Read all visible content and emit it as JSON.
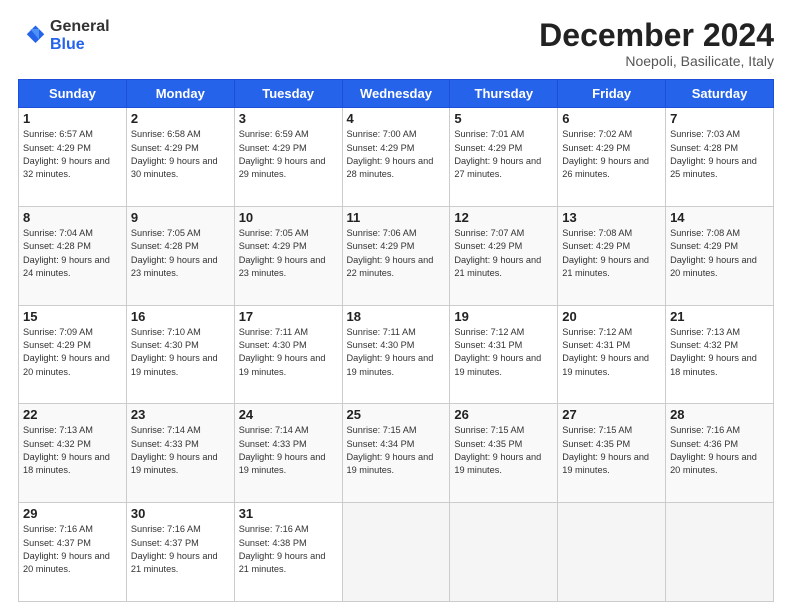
{
  "header": {
    "logo_general": "General",
    "logo_blue": "Blue",
    "month_title": "December 2024",
    "location": "Noepoli, Basilicate, Italy"
  },
  "days_of_week": [
    "Sunday",
    "Monday",
    "Tuesday",
    "Wednesday",
    "Thursday",
    "Friday",
    "Saturday"
  ],
  "weeks": [
    [
      {
        "day": "1",
        "sunrise": "6:57 AM",
        "sunset": "4:29 PM",
        "daylight": "9 hours and 32 minutes."
      },
      {
        "day": "2",
        "sunrise": "6:58 AM",
        "sunset": "4:29 PM",
        "daylight": "9 hours and 30 minutes."
      },
      {
        "day": "3",
        "sunrise": "6:59 AM",
        "sunset": "4:29 PM",
        "daylight": "9 hours and 29 minutes."
      },
      {
        "day": "4",
        "sunrise": "7:00 AM",
        "sunset": "4:29 PM",
        "daylight": "9 hours and 28 minutes."
      },
      {
        "day": "5",
        "sunrise": "7:01 AM",
        "sunset": "4:29 PM",
        "daylight": "9 hours and 27 minutes."
      },
      {
        "day": "6",
        "sunrise": "7:02 AM",
        "sunset": "4:29 PM",
        "daylight": "9 hours and 26 minutes."
      },
      {
        "day": "7",
        "sunrise": "7:03 AM",
        "sunset": "4:28 PM",
        "daylight": "9 hours and 25 minutes."
      }
    ],
    [
      {
        "day": "8",
        "sunrise": "7:04 AM",
        "sunset": "4:28 PM",
        "daylight": "9 hours and 24 minutes."
      },
      {
        "day": "9",
        "sunrise": "7:05 AM",
        "sunset": "4:28 PM",
        "daylight": "9 hours and 23 minutes."
      },
      {
        "day": "10",
        "sunrise": "7:05 AM",
        "sunset": "4:29 PM",
        "daylight": "9 hours and 23 minutes."
      },
      {
        "day": "11",
        "sunrise": "7:06 AM",
        "sunset": "4:29 PM",
        "daylight": "9 hours and 22 minutes."
      },
      {
        "day": "12",
        "sunrise": "7:07 AM",
        "sunset": "4:29 PM",
        "daylight": "9 hours and 21 minutes."
      },
      {
        "day": "13",
        "sunrise": "7:08 AM",
        "sunset": "4:29 PM",
        "daylight": "9 hours and 21 minutes."
      },
      {
        "day": "14",
        "sunrise": "7:08 AM",
        "sunset": "4:29 PM",
        "daylight": "9 hours and 20 minutes."
      }
    ],
    [
      {
        "day": "15",
        "sunrise": "7:09 AM",
        "sunset": "4:29 PM",
        "daylight": "9 hours and 20 minutes."
      },
      {
        "day": "16",
        "sunrise": "7:10 AM",
        "sunset": "4:30 PM",
        "daylight": "9 hours and 19 minutes."
      },
      {
        "day": "17",
        "sunrise": "7:11 AM",
        "sunset": "4:30 PM",
        "daylight": "9 hours and 19 minutes."
      },
      {
        "day": "18",
        "sunrise": "7:11 AM",
        "sunset": "4:30 PM",
        "daylight": "9 hours and 19 minutes."
      },
      {
        "day": "19",
        "sunrise": "7:12 AM",
        "sunset": "4:31 PM",
        "daylight": "9 hours and 19 minutes."
      },
      {
        "day": "20",
        "sunrise": "7:12 AM",
        "sunset": "4:31 PM",
        "daylight": "9 hours and 19 minutes."
      },
      {
        "day": "21",
        "sunrise": "7:13 AM",
        "sunset": "4:32 PM",
        "daylight": "9 hours and 18 minutes."
      }
    ],
    [
      {
        "day": "22",
        "sunrise": "7:13 AM",
        "sunset": "4:32 PM",
        "daylight": "9 hours and 18 minutes."
      },
      {
        "day": "23",
        "sunrise": "7:14 AM",
        "sunset": "4:33 PM",
        "daylight": "9 hours and 19 minutes."
      },
      {
        "day": "24",
        "sunrise": "7:14 AM",
        "sunset": "4:33 PM",
        "daylight": "9 hours and 19 minutes."
      },
      {
        "day": "25",
        "sunrise": "7:15 AM",
        "sunset": "4:34 PM",
        "daylight": "9 hours and 19 minutes."
      },
      {
        "day": "26",
        "sunrise": "7:15 AM",
        "sunset": "4:35 PM",
        "daylight": "9 hours and 19 minutes."
      },
      {
        "day": "27",
        "sunrise": "7:15 AM",
        "sunset": "4:35 PM",
        "daylight": "9 hours and 19 minutes."
      },
      {
        "day": "28",
        "sunrise": "7:16 AM",
        "sunset": "4:36 PM",
        "daylight": "9 hours and 20 minutes."
      }
    ],
    [
      {
        "day": "29",
        "sunrise": "7:16 AM",
        "sunset": "4:37 PM",
        "daylight": "9 hours and 20 minutes."
      },
      {
        "day": "30",
        "sunrise": "7:16 AM",
        "sunset": "4:37 PM",
        "daylight": "9 hours and 21 minutes."
      },
      {
        "day": "31",
        "sunrise": "7:16 AM",
        "sunset": "4:38 PM",
        "daylight": "9 hours and 21 minutes."
      },
      null,
      null,
      null,
      null
    ]
  ]
}
